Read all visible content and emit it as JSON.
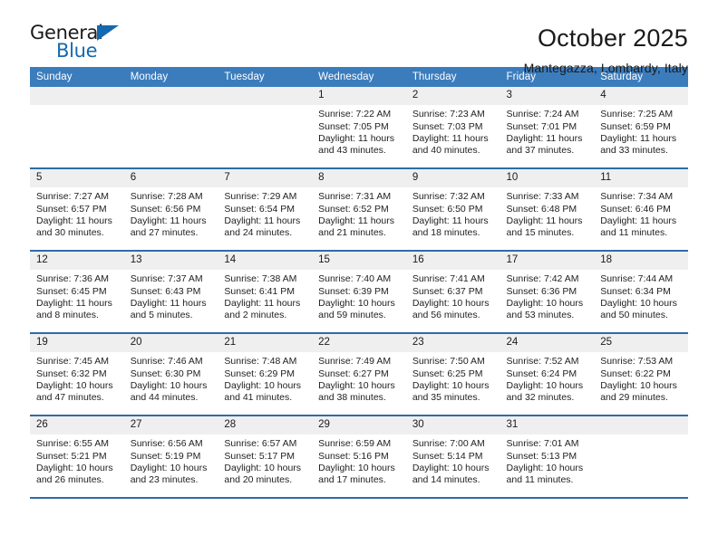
{
  "brand": {
    "name_top": "General",
    "name_bottom": "Blue",
    "triangle_color": "#1569b0"
  },
  "header": {
    "title": "October 2025",
    "location": "Mantegazza, Lombardy, Italy"
  },
  "theme": {
    "header_row_bg": "#3b7cbd",
    "row_divider": "#2f6ca8",
    "daynum_bg": "#efefef"
  },
  "weekday_headers": [
    "Sunday",
    "Monday",
    "Tuesday",
    "Wednesday",
    "Thursday",
    "Friday",
    "Saturday"
  ],
  "labels": {
    "sunrise_prefix": "Sunrise:",
    "sunset_prefix": "Sunset:",
    "daylight_prefix": "Daylight:"
  },
  "weeks": [
    [
      {
        "day": "",
        "sunrise": "",
        "sunset": "",
        "daylight_line1": "",
        "daylight_line2": ""
      },
      {
        "day": "",
        "sunrise": "",
        "sunset": "",
        "daylight_line1": "",
        "daylight_line2": ""
      },
      {
        "day": "",
        "sunrise": "",
        "sunset": "",
        "daylight_line1": "",
        "daylight_line2": ""
      },
      {
        "day": "1",
        "sunrise": "Sunrise: 7:22 AM",
        "sunset": "Sunset: 7:05 PM",
        "daylight_line1": "Daylight: 11 hours",
        "daylight_line2": "and 43 minutes."
      },
      {
        "day": "2",
        "sunrise": "Sunrise: 7:23 AM",
        "sunset": "Sunset: 7:03 PM",
        "daylight_line1": "Daylight: 11 hours",
        "daylight_line2": "and 40 minutes."
      },
      {
        "day": "3",
        "sunrise": "Sunrise: 7:24 AM",
        "sunset": "Sunset: 7:01 PM",
        "daylight_line1": "Daylight: 11 hours",
        "daylight_line2": "and 37 minutes."
      },
      {
        "day": "4",
        "sunrise": "Sunrise: 7:25 AM",
        "sunset": "Sunset: 6:59 PM",
        "daylight_line1": "Daylight: 11 hours",
        "daylight_line2": "and 33 minutes."
      }
    ],
    [
      {
        "day": "5",
        "sunrise": "Sunrise: 7:27 AM",
        "sunset": "Sunset: 6:57 PM",
        "daylight_line1": "Daylight: 11 hours",
        "daylight_line2": "and 30 minutes."
      },
      {
        "day": "6",
        "sunrise": "Sunrise: 7:28 AM",
        "sunset": "Sunset: 6:56 PM",
        "daylight_line1": "Daylight: 11 hours",
        "daylight_line2": "and 27 minutes."
      },
      {
        "day": "7",
        "sunrise": "Sunrise: 7:29 AM",
        "sunset": "Sunset: 6:54 PM",
        "daylight_line1": "Daylight: 11 hours",
        "daylight_line2": "and 24 minutes."
      },
      {
        "day": "8",
        "sunrise": "Sunrise: 7:31 AM",
        "sunset": "Sunset: 6:52 PM",
        "daylight_line1": "Daylight: 11 hours",
        "daylight_line2": "and 21 minutes."
      },
      {
        "day": "9",
        "sunrise": "Sunrise: 7:32 AM",
        "sunset": "Sunset: 6:50 PM",
        "daylight_line1": "Daylight: 11 hours",
        "daylight_line2": "and 18 minutes."
      },
      {
        "day": "10",
        "sunrise": "Sunrise: 7:33 AM",
        "sunset": "Sunset: 6:48 PM",
        "daylight_line1": "Daylight: 11 hours",
        "daylight_line2": "and 15 minutes."
      },
      {
        "day": "11",
        "sunrise": "Sunrise: 7:34 AM",
        "sunset": "Sunset: 6:46 PM",
        "daylight_line1": "Daylight: 11 hours",
        "daylight_line2": "and 11 minutes."
      }
    ],
    [
      {
        "day": "12",
        "sunrise": "Sunrise: 7:36 AM",
        "sunset": "Sunset: 6:45 PM",
        "daylight_line1": "Daylight: 11 hours",
        "daylight_line2": "and 8 minutes."
      },
      {
        "day": "13",
        "sunrise": "Sunrise: 7:37 AM",
        "sunset": "Sunset: 6:43 PM",
        "daylight_line1": "Daylight: 11 hours",
        "daylight_line2": "and 5 minutes."
      },
      {
        "day": "14",
        "sunrise": "Sunrise: 7:38 AM",
        "sunset": "Sunset: 6:41 PM",
        "daylight_line1": "Daylight: 11 hours",
        "daylight_line2": "and 2 minutes."
      },
      {
        "day": "15",
        "sunrise": "Sunrise: 7:40 AM",
        "sunset": "Sunset: 6:39 PM",
        "daylight_line1": "Daylight: 10 hours",
        "daylight_line2": "and 59 minutes."
      },
      {
        "day": "16",
        "sunrise": "Sunrise: 7:41 AM",
        "sunset": "Sunset: 6:37 PM",
        "daylight_line1": "Daylight: 10 hours",
        "daylight_line2": "and 56 minutes."
      },
      {
        "day": "17",
        "sunrise": "Sunrise: 7:42 AM",
        "sunset": "Sunset: 6:36 PM",
        "daylight_line1": "Daylight: 10 hours",
        "daylight_line2": "and 53 minutes."
      },
      {
        "day": "18",
        "sunrise": "Sunrise: 7:44 AM",
        "sunset": "Sunset: 6:34 PM",
        "daylight_line1": "Daylight: 10 hours",
        "daylight_line2": "and 50 minutes."
      }
    ],
    [
      {
        "day": "19",
        "sunrise": "Sunrise: 7:45 AM",
        "sunset": "Sunset: 6:32 PM",
        "daylight_line1": "Daylight: 10 hours",
        "daylight_line2": "and 47 minutes."
      },
      {
        "day": "20",
        "sunrise": "Sunrise: 7:46 AM",
        "sunset": "Sunset: 6:30 PM",
        "daylight_line1": "Daylight: 10 hours",
        "daylight_line2": "and 44 minutes."
      },
      {
        "day": "21",
        "sunrise": "Sunrise: 7:48 AM",
        "sunset": "Sunset: 6:29 PM",
        "daylight_line1": "Daylight: 10 hours",
        "daylight_line2": "and 41 minutes."
      },
      {
        "day": "22",
        "sunrise": "Sunrise: 7:49 AM",
        "sunset": "Sunset: 6:27 PM",
        "daylight_line1": "Daylight: 10 hours",
        "daylight_line2": "and 38 minutes."
      },
      {
        "day": "23",
        "sunrise": "Sunrise: 7:50 AM",
        "sunset": "Sunset: 6:25 PM",
        "daylight_line1": "Daylight: 10 hours",
        "daylight_line2": "and 35 minutes."
      },
      {
        "day": "24",
        "sunrise": "Sunrise: 7:52 AM",
        "sunset": "Sunset: 6:24 PM",
        "daylight_line1": "Daylight: 10 hours",
        "daylight_line2": "and 32 minutes."
      },
      {
        "day": "25",
        "sunrise": "Sunrise: 7:53 AM",
        "sunset": "Sunset: 6:22 PM",
        "daylight_line1": "Daylight: 10 hours",
        "daylight_line2": "and 29 minutes."
      }
    ],
    [
      {
        "day": "26",
        "sunrise": "Sunrise: 6:55 AM",
        "sunset": "Sunset: 5:21 PM",
        "daylight_line1": "Daylight: 10 hours",
        "daylight_line2": "and 26 minutes."
      },
      {
        "day": "27",
        "sunrise": "Sunrise: 6:56 AM",
        "sunset": "Sunset: 5:19 PM",
        "daylight_line1": "Daylight: 10 hours",
        "daylight_line2": "and 23 minutes."
      },
      {
        "day": "28",
        "sunrise": "Sunrise: 6:57 AM",
        "sunset": "Sunset: 5:17 PM",
        "daylight_line1": "Daylight: 10 hours",
        "daylight_line2": "and 20 minutes."
      },
      {
        "day": "29",
        "sunrise": "Sunrise: 6:59 AM",
        "sunset": "Sunset: 5:16 PM",
        "daylight_line1": "Daylight: 10 hours",
        "daylight_line2": "and 17 minutes."
      },
      {
        "day": "30",
        "sunrise": "Sunrise: 7:00 AM",
        "sunset": "Sunset: 5:14 PM",
        "daylight_line1": "Daylight: 10 hours",
        "daylight_line2": "and 14 minutes."
      },
      {
        "day": "31",
        "sunrise": "Sunrise: 7:01 AM",
        "sunset": "Sunset: 5:13 PM",
        "daylight_line1": "Daylight: 10 hours",
        "daylight_line2": "and 11 minutes."
      },
      {
        "day": "",
        "sunrise": "",
        "sunset": "",
        "daylight_line1": "",
        "daylight_line2": ""
      }
    ]
  ]
}
